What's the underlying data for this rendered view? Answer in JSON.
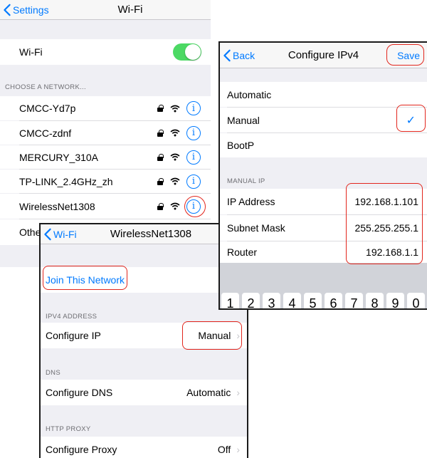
{
  "wifi_screen": {
    "back_label": "Settings",
    "title": "Wi-Fi",
    "wifi_label": "Wi-Fi",
    "section_header": "CHOOSE A NETWORK...",
    "networks": [
      {
        "name": "CMCC-Yd7p"
      },
      {
        "name": "CMCC-zdnf"
      },
      {
        "name": "MERCURY_310A"
      },
      {
        "name": "TP-LINK_2.4GHz_zh"
      },
      {
        "name": "WirelessNet1308"
      }
    ],
    "other_label": "Other..."
  },
  "network_screen": {
    "back_label": "Wi-Fi",
    "title": "WirelessNet1308",
    "join_label": "Join This Network",
    "ipv4_header": "IPV4 ADDRESS",
    "configure_ip_label": "Configure IP",
    "configure_ip_value": "Manual",
    "dns_header": "DNS",
    "configure_dns_label": "Configure DNS",
    "configure_dns_value": "Automatic",
    "proxy_header": "HTTP PROXY",
    "configure_proxy_label": "Configure Proxy",
    "configure_proxy_value": "Off"
  },
  "ipv4_screen": {
    "back_label": "Back",
    "title": "Configure IPv4",
    "save_label": "Save",
    "options": [
      "Automatic",
      "Manual",
      "BootP"
    ],
    "manual_ip_header": "MANUAL IP",
    "ip_address_label": "IP Address",
    "ip_address_value": "192.168.1.101",
    "subnet_mask_label": "Subnet Mask",
    "subnet_mask_value": "255.255.255.1",
    "router_label": "Router",
    "router_value": "192.168.1.1",
    "keys": [
      "1",
      "2",
      "3",
      "4",
      "5",
      "6",
      "7",
      "8",
      "9",
      "0"
    ]
  },
  "colors": {
    "ios_blue": "#007aff",
    "toggle_green": "#4cd964",
    "highlight_red": "#e2261d"
  }
}
